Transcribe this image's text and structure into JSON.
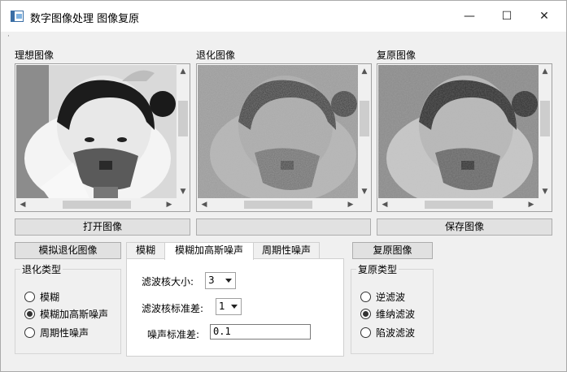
{
  "window": {
    "title": "数字图像处理 图像复原",
    "minimize_glyph": "—",
    "maximize_glyph": "☐",
    "close_glyph": "✕"
  },
  "panels": {
    "ideal_label": "理想图像",
    "degraded_label": "退化图像",
    "restored_label": "复原图像"
  },
  "buttons": {
    "open_image": "打开图像",
    "middle_blank": "",
    "save_image": "保存图像",
    "simulate_degradation": "模拟退化图像",
    "restore_image": "复原图像"
  },
  "degradation_type": {
    "label": "退化类型",
    "options": [
      "模糊",
      "模糊加高斯噪声",
      "周期性噪声"
    ],
    "selected_index": 1
  },
  "tabs": {
    "items": [
      "模糊",
      "模糊加高斯噪声",
      "周期性噪声"
    ],
    "active_index": 1
  },
  "params": {
    "kernel_size_label": "滤波核大小:",
    "kernel_size_value": "3",
    "kernel_sigma_label": "滤波核标准差:",
    "kernel_sigma_value": "1",
    "noise_sigma_label": "噪声标准差:",
    "noise_sigma_value": "0.1"
  },
  "restore_type": {
    "label": "复原类型",
    "options": [
      "逆滤波",
      "维纳滤波",
      "陷波滤波"
    ],
    "selected_index": 1
  },
  "icons": {
    "app": "app-window-icon",
    "scroll_up": "▲",
    "scroll_down": "▼",
    "scroll_left": "◀",
    "scroll_right": "▶"
  }
}
